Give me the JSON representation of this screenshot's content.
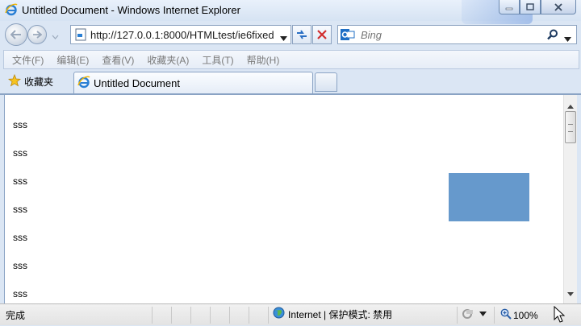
{
  "window": {
    "title": "Untitled Document - Windows Internet Explorer"
  },
  "navigation": {
    "address_url": "http://127.0.0.1:8000/HTMLtest/ie6fixed",
    "search_placeholder": "Bing"
  },
  "menu": {
    "items": [
      "文件(F)",
      "编辑(E)",
      "查看(V)",
      "收藏夹(A)",
      "工具(T)",
      "帮助(H)"
    ]
  },
  "favorites": {
    "label": "收藏夹"
  },
  "tabs": [
    {
      "label": "Untitled Document",
      "active": true
    }
  ],
  "content": {
    "lines": [
      "sss",
      "sss",
      "sss",
      "sss",
      "sss",
      "sss",
      "sss"
    ],
    "fixed_box_color": "#6699cc"
  },
  "status": {
    "text": "完成",
    "zone": "Internet | 保护模式: 禁用",
    "zoom": "100%"
  },
  "icons": {
    "app": "ie-logo-icon",
    "back": "back-arrow-icon",
    "forward": "forward-arrow-icon",
    "refresh": "refresh-icon",
    "stop": "stop-icon",
    "search": "search-icon",
    "favorites": "star-icon",
    "zone": "globe-icon",
    "zoom": "zoom-icon"
  }
}
